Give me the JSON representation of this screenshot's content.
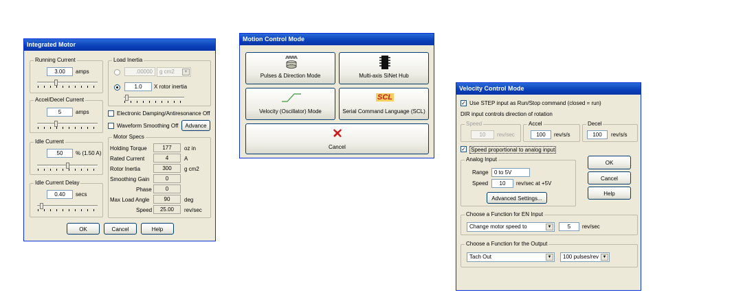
{
  "integrated_motor": {
    "title": "Integrated Motor",
    "running_current": {
      "label": "Running Current",
      "value": "3.00",
      "unit": "amps"
    },
    "accel_decel_current": {
      "label": "Accel/Decel Current",
      "value": "5",
      "unit": "amps"
    },
    "idle_current": {
      "label": "Idle Current",
      "value": "50",
      "unit": "% (1.50 A)"
    },
    "idle_current_delay": {
      "label": "Idle Current Delay",
      "value": "0.40",
      "unit": "secs"
    },
    "load_inertia": {
      "label": "Load Inertia",
      "abs_value": ".00000",
      "abs_unit": "g cm2",
      "ratio_value": "1.0",
      "ratio_unit": "X rotor inertia"
    },
    "electronic_damping_label": "Electronic Damping/Antiresonance Off",
    "waveform_smoothing_label": "Waveform Smoothing Off",
    "advance_button": "Advance",
    "motor_specs": {
      "label": "Motor Specs",
      "rows": [
        {
          "label": "Holding Torque",
          "value": "177",
          "unit": "oz in"
        },
        {
          "label": "Rated Current",
          "value": "4",
          "unit": "A"
        },
        {
          "label": "Rotor Inertia",
          "value": "300",
          "unit": "g cm2"
        },
        {
          "label": "Smoothing Gain",
          "value": "0",
          "unit": ""
        },
        {
          "label": "Phase",
          "value": "0",
          "unit": ""
        },
        {
          "label": "Max Load Angle",
          "value": "90",
          "unit": "deg"
        },
        {
          "label": "Speed",
          "value": "25.00",
          "unit": "rev/sec"
        }
      ]
    },
    "buttons": {
      "ok": "OK",
      "cancel": "Cancel",
      "help": "Help"
    },
    "sliders": {
      "running": 0.3,
      "accel": 0.3,
      "idle": 0.5,
      "delay": 0.05,
      "inertia": 0.02
    }
  },
  "motion_control_mode": {
    "title": "Motion Control Mode",
    "pulses_direction": "Pulses & Direction Mode",
    "multiaxis": "Multi-axis SiNet Hub",
    "velocity_mode": "Velocity (Oscillator) Mode",
    "scl_mode": "Serial Command Language (SCL)",
    "scl_icon_text": "SCL",
    "cancel": "Cancel"
  },
  "velocity_control_mode": {
    "title": "Velocity Control Mode",
    "use_step_label": "Use STEP input as Run/Stop command (closed = run)",
    "dir_note": "DIR input controls direction of rotation",
    "speed": {
      "label": "Speed",
      "value": "10",
      "unit": "rev/sec"
    },
    "accel": {
      "label": "Accel",
      "value": "100",
      "unit": "rev/s/s"
    },
    "decel": {
      "label": "Decel",
      "value": "100",
      "unit": "rev/s/s"
    },
    "speed_proportional_label": "Speed proportional to analog input",
    "analog_input": {
      "label": "Analog Input",
      "range_label": "Range",
      "range_value": "0 to 5V",
      "speed_label": "Speed",
      "speed_value": "10",
      "speed_unit": "rev/sec at +5V",
      "advanced_button": "Advanced Settings..."
    },
    "en_input": {
      "label": "Choose a Function for EN Input",
      "selected": "Change motor speed to",
      "value": "5",
      "unit": "rev/sec"
    },
    "output": {
      "label": "Choose a Function for the Output",
      "selected": "Tach Out",
      "pulses": "100 pulses/rev"
    },
    "buttons": {
      "ok": "OK",
      "cancel": "Cancel",
      "help": "Help"
    }
  }
}
